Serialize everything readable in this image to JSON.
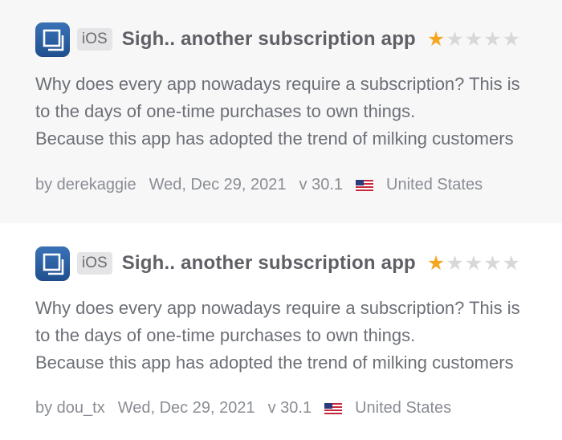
{
  "reviews": [
    {
      "platform": "iOS",
      "title": "Sigh.. another subscription app",
      "rating": 1,
      "rating_max": 5,
      "body_lines": [
        "Why does every app nowadays require a subscription? This is",
        "to the days of one-time purchases to own things.",
        "Because this app has adopted the trend of milking customers"
      ],
      "author": "by derekaggie",
      "date": "Wed, Dec 29, 2021",
      "version": "v 30.1",
      "country": "United States"
    },
    {
      "platform": "iOS",
      "title": "Sigh.. another subscription app",
      "rating": 1,
      "rating_max": 5,
      "body_lines": [
        "Why does every app nowadays require a subscription? This is",
        "to the days of one-time purchases to own things.",
        "Because this app has adopted the trend of milking customers"
      ],
      "author": "by dou_tx",
      "date": "Wed, Dec 29, 2021",
      "version": "v 30.1",
      "country": "United States"
    }
  ],
  "colors": {
    "star_on": "#f5a623",
    "star_off": "#d8d8da",
    "app_icon": "#2c5fa0"
  }
}
